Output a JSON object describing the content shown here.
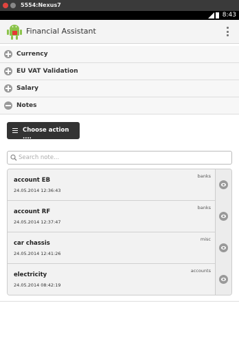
{
  "window": {
    "title": "5554:Nexus7"
  },
  "statusbar": {
    "time": "8:43"
  },
  "actionbar": {
    "app_title": "Financial Assistant",
    "logo_icon": "android-robot-icon",
    "menu_icon": "overflow-menu-icon"
  },
  "sections": [
    {
      "label": "Currency",
      "state": "collapsed"
    },
    {
      "label": "EU VAT Validation",
      "state": "collapsed"
    },
    {
      "label": "Salary",
      "state": "collapsed"
    },
    {
      "label": "Notes",
      "state": "expanded"
    }
  ],
  "notes": {
    "action_button": "Choose action ....",
    "search_placeholder": "Search note...",
    "items": [
      {
        "name": "account EB",
        "date": "24.05.2014 12:36:43",
        "category": "banks"
      },
      {
        "name": "account RF",
        "date": "24.05.2014 12:37:47",
        "category": "banks"
      },
      {
        "name": "car chassis",
        "date": "24.05.2014 12:41:26",
        "category": "misc"
      },
      {
        "name": "electricity",
        "date": "24.05.2014 08:42:19",
        "category": "accounts"
      }
    ]
  }
}
